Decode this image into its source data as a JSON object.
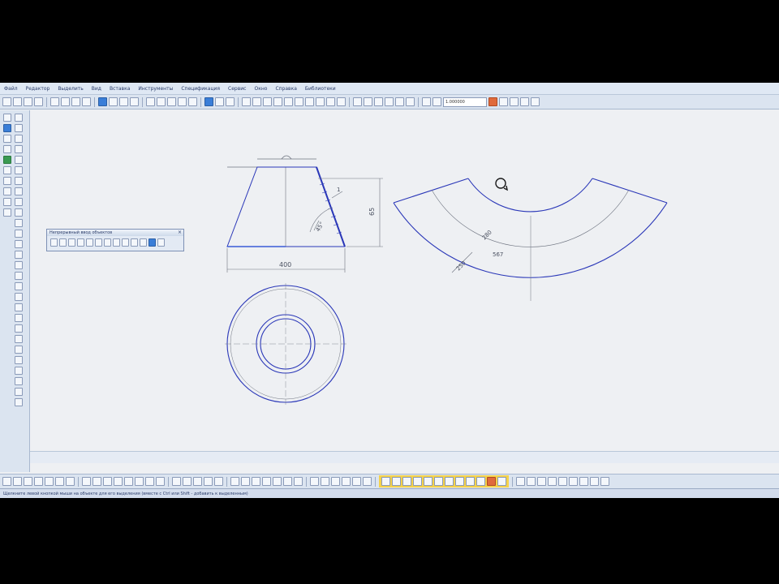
{
  "menu": {
    "items": [
      "Файл",
      "Редактор",
      "Выделить",
      "Вид",
      "Вставка",
      "Инструменты",
      "Спецификация",
      "Сервис",
      "Окно",
      "Справка",
      "Библиотеки"
    ]
  },
  "toolbar": {
    "zoom_value": "1.000000"
  },
  "panel": {
    "title": "Непрерывный ввод объектов"
  },
  "drawing": {
    "dim_width": "400",
    "dim_height": "65",
    "dim_slant_angle": "45°",
    "dim_slant_len": "1",
    "dim_inner_radius": "280",
    "dim_outer_radius": "567",
    "dim_arc_width": "250"
  },
  "status": {
    "text": "Щелкните левой кнопкой мыши на объекте для его выделения (вместе с Ctrl или Shift - добавить к выделенным)"
  },
  "colors": {
    "line_blue": "#2a37b8",
    "line_gray": "#6e7480",
    "accent": "#3a7ed8",
    "highlight": "#f5d24a"
  }
}
